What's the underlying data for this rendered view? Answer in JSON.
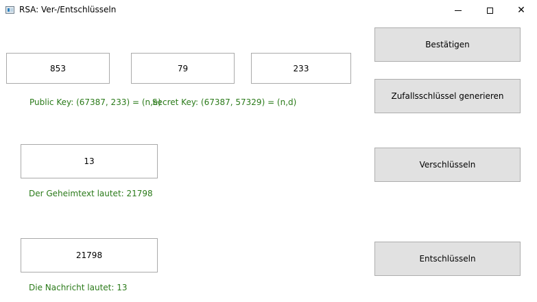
{
  "window": {
    "title": "RSA: Ver-/Entschlüsseln",
    "controls": {
      "minimize_icon": "minimize-icon",
      "maximize_icon": "maximize-icon",
      "close_icon": "close-icon",
      "close_glyph": "✕"
    }
  },
  "inputs": {
    "p_value": "853",
    "q_value": "79",
    "e_value": "233",
    "message_value": "13",
    "ciphertext_value": "21798"
  },
  "labels": {
    "public_key": "Public Key: (67387, 233) = (n,e)",
    "secret_key": "Secret Key: (67387, 57329) = (n,d)",
    "ciphertext_result": "Der Geheimtext lautet: 21798",
    "plaintext_result": "Die Nachricht lautet: 13"
  },
  "buttons": {
    "confirm": "Bestätigen",
    "random_key": "Zufallsschlüssel generieren",
    "encrypt": "Verschlüsseln",
    "decrypt": "Entschlüsseln"
  },
  "colors": {
    "label_text": "#2a7a19",
    "button_background": "#e1e1e1",
    "button_border": "#adadad",
    "input_border": "#a9a9a9"
  }
}
